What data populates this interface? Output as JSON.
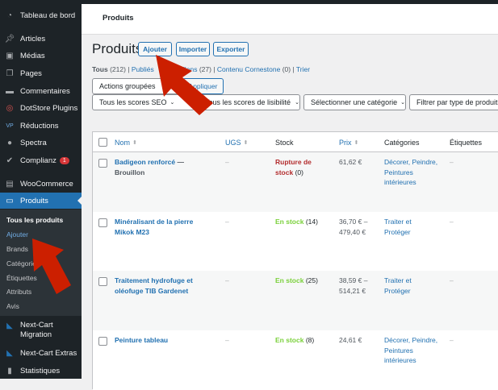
{
  "sidebar": {
    "items": [
      {
        "label": "Tableau de bord",
        "icon": "dashboard-icon"
      },
      {
        "label": "Articles",
        "icon": "pin-icon"
      },
      {
        "label": "Médias",
        "icon": "media-icon"
      },
      {
        "label": "Pages",
        "icon": "pages-icon"
      },
      {
        "label": "Commentaires",
        "icon": "comment-icon"
      },
      {
        "label": "DotStore Plugins",
        "icon": "dotstore-icon"
      },
      {
        "label": "Réductions",
        "icon": "vp-icon"
      },
      {
        "label": "Spectra",
        "icon": "spectra-icon"
      },
      {
        "label": "Complianz",
        "icon": "check-icon",
        "badge": "1"
      },
      {
        "label": "WooCommerce",
        "icon": "woo-icon"
      },
      {
        "label": "Produits",
        "icon": "archive-icon"
      },
      {
        "label": "Next-Cart Migration",
        "icon": "nextcart-icon"
      },
      {
        "label": "Next-Cart Extras",
        "icon": "nextcart-icon"
      },
      {
        "label": "Statistiques",
        "icon": "chart-icon"
      }
    ],
    "submenu": [
      "Tous les produits",
      "Ajouter",
      "Brands",
      "Catégories",
      "Étiquettes",
      "Attributs",
      "Avis"
    ]
  },
  "header": {
    "title": "Produits"
  },
  "page": {
    "title": "Produits",
    "buttons": [
      "Ajouter",
      "Importer",
      "Exporter"
    ]
  },
  "filters_status": {
    "all": "Tous",
    "all_count": "(212)",
    "published": "Publiés",
    "drafts": "Brouillons",
    "drafts_count": "(27)",
    "cornerstone": "Contenu Cornestone",
    "cornerstone_count": "(0)",
    "sort": "Trier"
  },
  "bulk": {
    "select": "Actions groupées",
    "apply": "Appliquer"
  },
  "filters": [
    "Tous les scores SEO",
    "Tous les scores de lisibilité",
    "Sélectionner une catégorie",
    "Filtrer par type de produit"
  ],
  "table": {
    "columns": [
      "Nom",
      "UGS",
      "Stock",
      "Prix",
      "Catégories",
      "Étiquettes"
    ],
    "rows": [
      {
        "name": "Badigeon renforcé",
        "state": "— Brouillon",
        "ugs": "–",
        "stock": "Rupture de stock",
        "stock_count": "(0)",
        "price": "61,62 €",
        "categories": "Décorer, Peindre, Peintures intérieures",
        "tags": "–"
      },
      {
        "name": "Minéralisant de la pierre Mikok M23",
        "ugs": "–",
        "stock": "En stock",
        "stock_count": "(14)",
        "price": "36,70 € – 479,40 €",
        "categories": "Traiter et Protéger",
        "tags": "–"
      },
      {
        "name": "Traitement hydrofuge et oléofuge TIB Gardenet",
        "ugs": "–",
        "stock": "En stock",
        "stock_count": "(25)",
        "price": "38,59 € – 514,21 €",
        "categories": "Traiter et Protéger",
        "tags": "–"
      },
      {
        "name": "Peinture tableau",
        "ugs": "–",
        "stock": "En stock",
        "stock_count": "(8)",
        "price": "24,61 €",
        "categories": "Décorer, Peindre, Peintures intérieures",
        "tags": "–"
      }
    ]
  }
}
